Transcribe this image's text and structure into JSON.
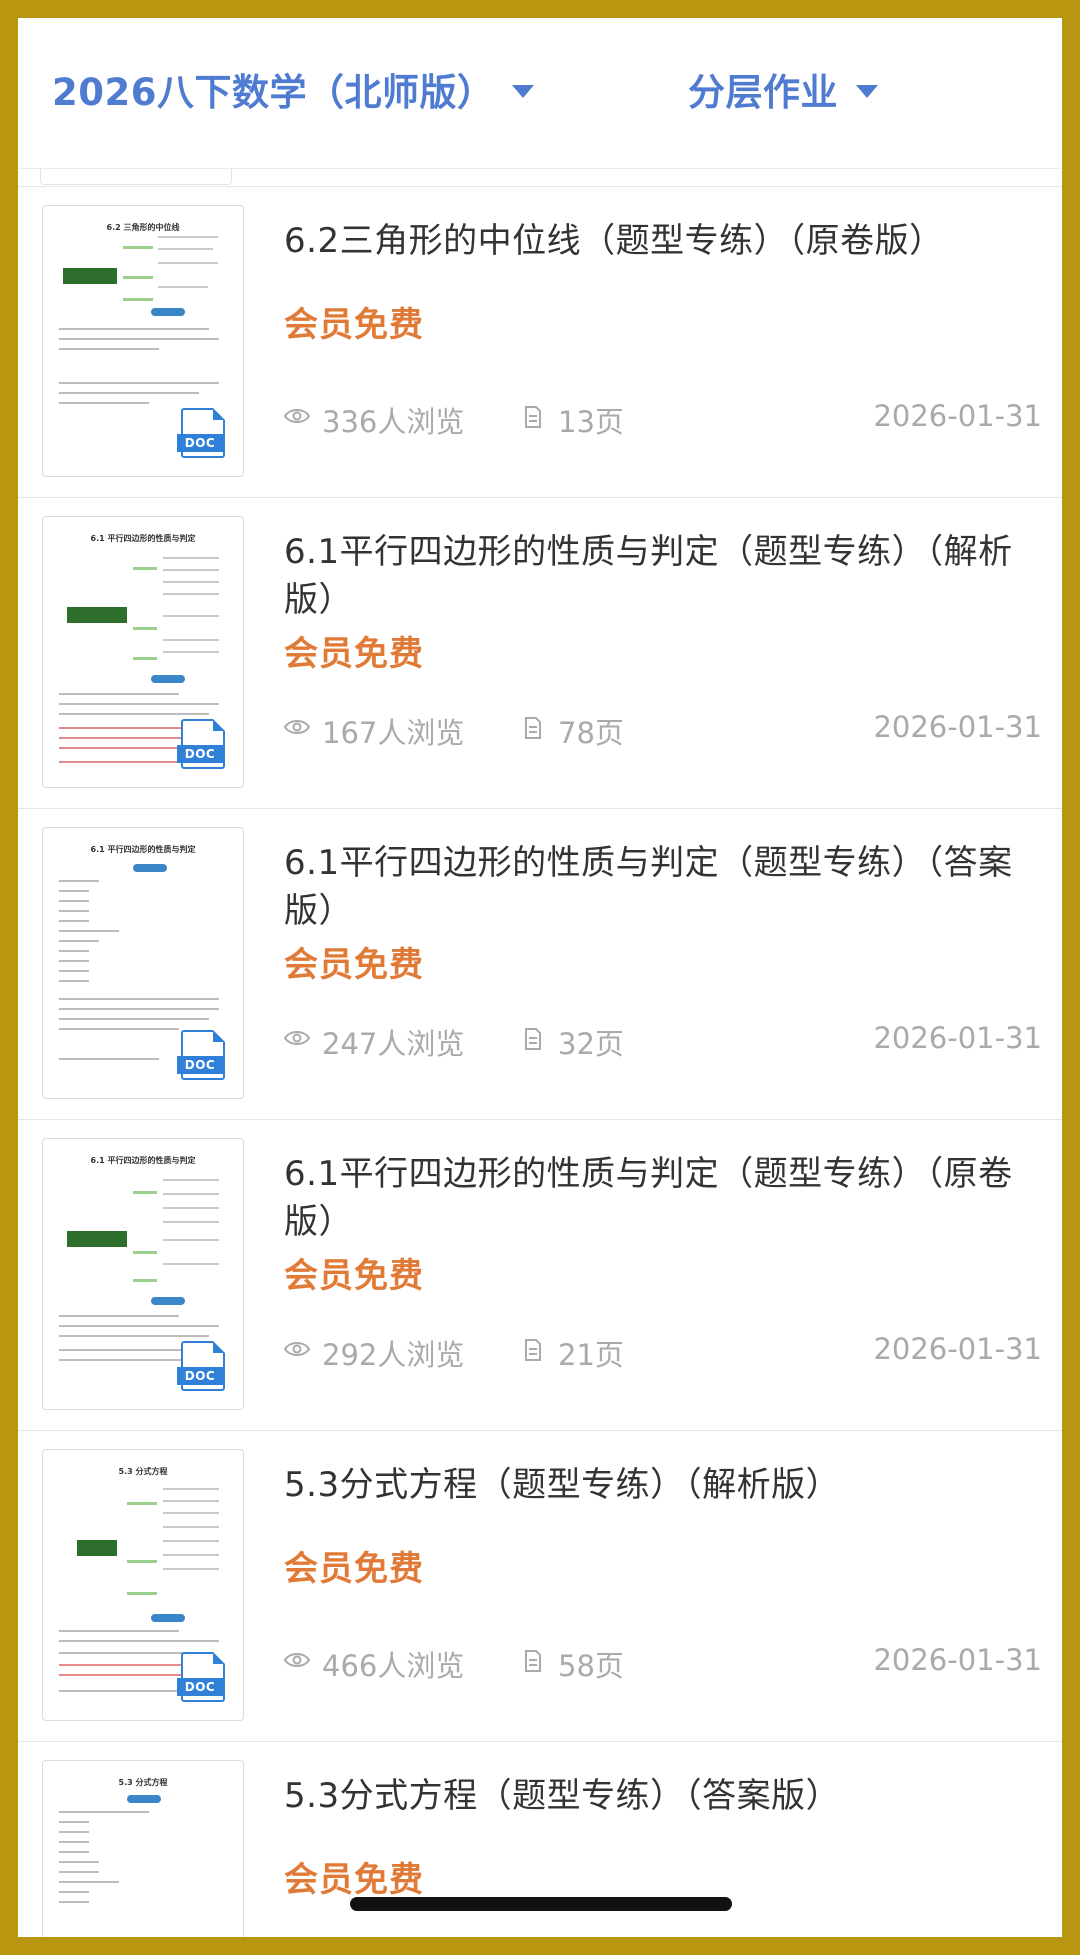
{
  "header": {
    "book_select": "2026八下数学（北师版）",
    "category_select": "分层作业"
  },
  "items": [
    {
      "title": "6.2三角形的中位线（题型专练）（原卷版）",
      "price": "会员免费",
      "views": "336人浏览",
      "pages": "13页",
      "date": "2026-01-31",
      "thumb_title": "6.2 三角形的中位线",
      "file_type": "DOC"
    },
    {
      "title": "6.1平行四边形的性质与判定（题型专练）（解析版）",
      "price": "会员免费",
      "views": "167人浏览",
      "pages": "78页",
      "date": "2026-01-31",
      "thumb_title": "6.1 平行四边形的性质与判定",
      "file_type": "DOC"
    },
    {
      "title": "6.1平行四边形的性质与判定（题型专练）（答案版）",
      "price": "会员免费",
      "views": "247人浏览",
      "pages": "32页",
      "date": "2026-01-31",
      "thumb_title": "6.1 平行四边形的性质与判定",
      "file_type": "DOC"
    },
    {
      "title": "6.1平行四边形的性质与判定（题型专练）（原卷版）",
      "price": "会员免费",
      "views": "292人浏览",
      "pages": "21页",
      "date": "2026-01-31",
      "thumb_title": "6.1 平行四边形的性质与判定",
      "file_type": "DOC"
    },
    {
      "title": "5.3分式方程（题型专练）（解析版）",
      "price": "会员免费",
      "views": "466人浏览",
      "pages": "58页",
      "date": "2026-01-31",
      "thumb_title": "5.3 分式方程",
      "file_type": "DOC"
    },
    {
      "title": "5.3分式方程（题型专练）（答案版）",
      "price": "会员免费",
      "thumb_title": "5.3 分式方程"
    }
  ],
  "colors": {
    "accent_blue": "#4f7bd1",
    "price_orange": "#e07a36",
    "frame_gold": "#b8960f",
    "doc_blue": "#2f80d6"
  },
  "icons": [
    "chevron-down-icon",
    "eye-icon",
    "document-icon",
    "doc-file-icon"
  ]
}
